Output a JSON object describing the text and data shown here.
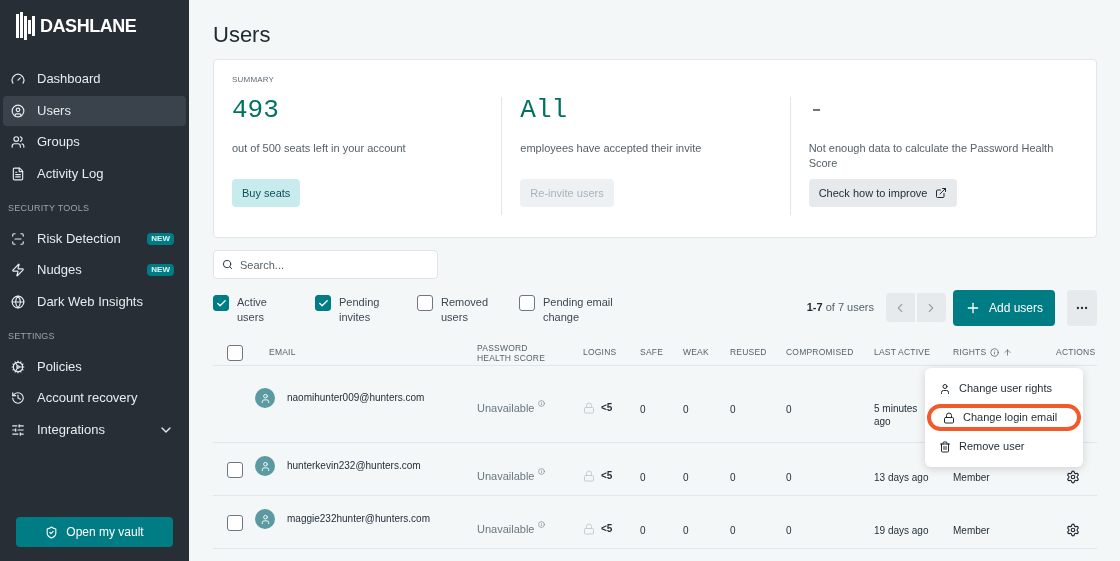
{
  "sidebar": {
    "logo": "DASHLANE",
    "sections": [
      {
        "items": [
          {
            "label": "Dashboard",
            "selected": false
          },
          {
            "label": "Users",
            "selected": true
          },
          {
            "label": "Groups",
            "selected": false
          },
          {
            "label": "Activity Log",
            "selected": false
          }
        ]
      },
      {
        "heading": "SECURITY TOOLS",
        "items": [
          {
            "label": "Risk Detection",
            "selected": false,
            "badge": "NEW"
          },
          {
            "label": "Nudges",
            "selected": false,
            "badge": "NEW"
          },
          {
            "label": "Dark Web Insights",
            "selected": false
          }
        ]
      },
      {
        "heading": "SETTINGS",
        "items": [
          {
            "label": "Policies",
            "selected": false
          },
          {
            "label": "Account recovery",
            "selected": false
          },
          {
            "label": "Integrations",
            "selected": false,
            "expanded": false
          }
        ]
      }
    ],
    "vault_button": "Open my vault"
  },
  "page_title": "Users",
  "summary": {
    "heading": "SUMMARY",
    "stats": [
      {
        "value": "493",
        "muted": false,
        "caption": "out of 500 seats left in your account",
        "button": {
          "label": "Buy seats",
          "kind": "tinted",
          "disabled": false
        }
      },
      {
        "value": "All",
        "muted": false,
        "caption": "employees have accepted their invite",
        "button": {
          "label": "Re-invite users",
          "kind": "tinted",
          "disabled": true
        }
      },
      {
        "value": "-",
        "muted": true,
        "caption": "Not enough data to calculate the Password Health Score",
        "button": {
          "label": "Check how to improve",
          "kind": "external",
          "disabled": false
        }
      }
    ]
  },
  "search": {
    "placeholder": "Search..."
  },
  "filters": [
    {
      "label": "Active users",
      "checked": true
    },
    {
      "label": "Pending invites",
      "checked": true
    },
    {
      "label": "Removed users",
      "checked": false
    },
    {
      "label": "Pending email change",
      "checked": false
    }
  ],
  "pagination": {
    "range": "1-7",
    "total": "of 7 users"
  },
  "add_button": "Add users",
  "table": {
    "select_all": {
      "checked": false
    },
    "columns": [
      {
        "label": "EMAIL"
      },
      {
        "label": "PASSWORD HEALTH SCORE"
      },
      {
        "label": "LOGINS"
      },
      {
        "label": "SAFE"
      },
      {
        "label": "WEAK"
      },
      {
        "label": "REUSED"
      },
      {
        "label": "COMPROMISED"
      },
      {
        "label": "LAST ACTIVE"
      },
      {
        "label": "RIGHTS",
        "sorted": true
      },
      {
        "label": "ACTIONS"
      }
    ],
    "rows": [
      {
        "email": "naomihunter009@hunters.com",
        "health": "Unavailable",
        "logins": "<5",
        "safe": "0",
        "weak": "0",
        "reused": "0",
        "compromised": "0",
        "last_active": "5 minutes ago",
        "menu_open": true
      },
      {
        "email": "hunterkevin232@hunters.com",
        "health": "Unavailable",
        "logins": "<5",
        "safe": "0",
        "weak": "0",
        "reused": "0",
        "compromised": "0",
        "last_active": "13 days ago",
        "rights": "Member",
        "menu_open": false,
        "checked": false
      },
      {
        "email": "maggie232hunter@hunters.com",
        "health": "Unavailable",
        "logins": "<5",
        "safe": "0",
        "weak": "0",
        "reused": "0",
        "compromised": "0",
        "last_active": "19 days ago",
        "rights": "Member",
        "menu_open": false,
        "checked": false
      }
    ]
  },
  "menu": {
    "items": [
      {
        "label": "Change user rights",
        "highlighted": false
      },
      {
        "label": "Change login email",
        "highlighted": true
      },
      {
        "label": "Remove user",
        "highlighted": false
      }
    ]
  }
}
